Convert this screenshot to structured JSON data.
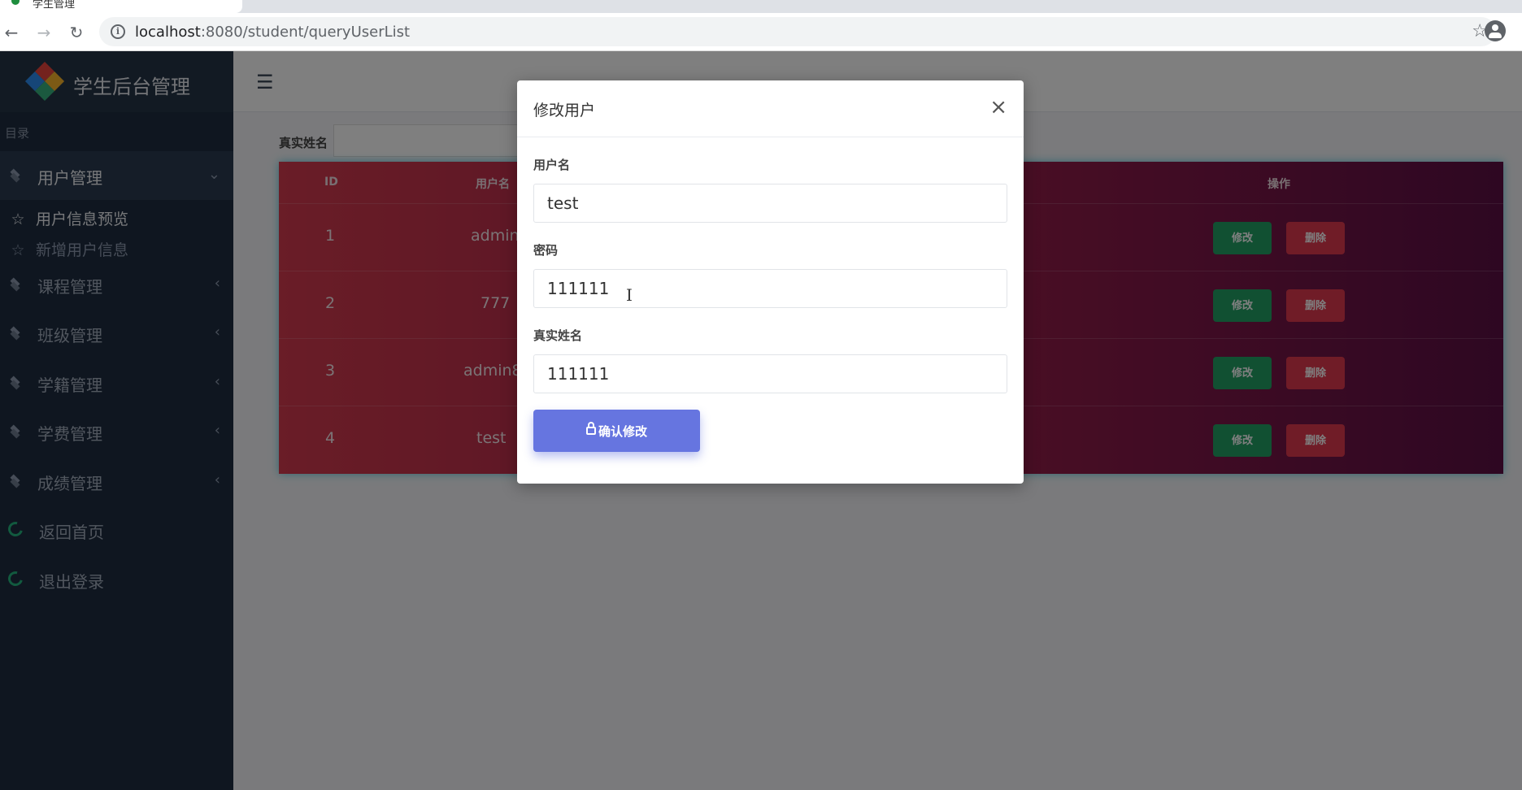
{
  "browser": {
    "tab_title": "学生管理",
    "url_host": "localhost",
    "url_path": ":8080/student/queryUserList"
  },
  "app": {
    "brand_title": "学生后台管理",
    "menu_caption": "目录"
  },
  "sidebar": {
    "items": [
      {
        "label": "用户管理",
        "icon": "layers-icon",
        "expanded": true
      },
      {
        "label": "课程管理",
        "icon": "layers-icon"
      },
      {
        "label": "班级管理",
        "icon": "layers-icon"
      },
      {
        "label": "学籍管理",
        "icon": "layers-icon"
      },
      {
        "label": "学费管理",
        "icon": "layers-icon"
      },
      {
        "label": "成绩管理",
        "icon": "layers-icon"
      },
      {
        "label": "返回首页",
        "icon": "ring-icon"
      },
      {
        "label": "退出登录",
        "icon": "ring-icon"
      }
    ],
    "sub_items": [
      {
        "label": "用户信息预览",
        "icon": "star-icon",
        "active": true
      },
      {
        "label": "新增用户信息",
        "icon": "star-outline-icon"
      }
    ]
  },
  "filter": {
    "label": "真实姓名"
  },
  "table": {
    "headers": [
      "ID",
      "用户名",
      "操作"
    ],
    "rows": [
      {
        "id": "1",
        "username": "admin"
      },
      {
        "id": "2",
        "username": "777"
      },
      {
        "id": "3",
        "username": "admin8"
      },
      {
        "id": "4",
        "username": "test"
      }
    ],
    "edit_label": "修改",
    "delete_label": "删除"
  },
  "modal": {
    "title": "修改用户",
    "close_symbol": "×",
    "username_label": "用户名",
    "username_value": "test",
    "password_label": "密码",
    "password_value": "111111",
    "realname_label": "真实姓名",
    "realname_value": "111111",
    "confirm_label": "确认修改"
  },
  "colors": {
    "sidebar": "#1e2d41",
    "edit_button": "#23a064",
    "delete_button": "#e0394f",
    "confirm_button": "#6675e0"
  }
}
